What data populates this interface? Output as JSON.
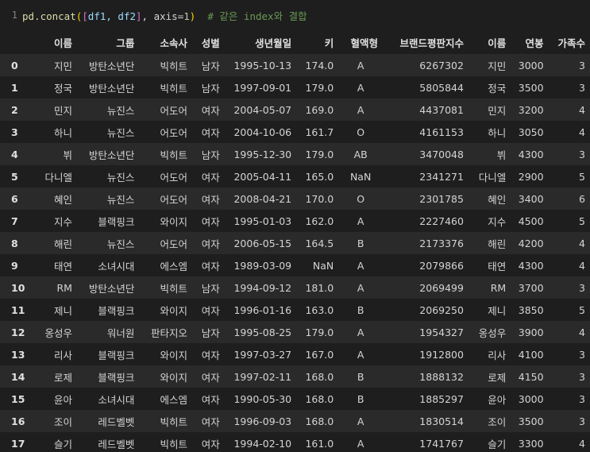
{
  "code_cell": {
    "line_number": "1",
    "code_fn": "pd.concat",
    "code_open": "(",
    "code_list_open": "[",
    "code_args": "df1, df2",
    "code_list_close": "]",
    "code_kw": ", axis=",
    "code_num": "1",
    "code_close": ")",
    "comment": "# 같은 index와 결합"
  },
  "table": {
    "columns": [
      "",
      "이름",
      "그룹",
      "소속사",
      "성별",
      "생년월일",
      "키",
      "혈액형",
      "브랜드평판지수",
      "이름",
      "연봉",
      "가족수"
    ],
    "rows": [
      [
        "0",
        "지민",
        "방탄소년단",
        "빅히트",
        "남자",
        "1995-10-13",
        "174.0",
        "A",
        "6267302",
        "지민",
        "3000",
        "3"
      ],
      [
        "1",
        "정국",
        "방탄소년단",
        "빅히트",
        "남자",
        "1997-09-01",
        "179.0",
        "A",
        "5805844",
        "정국",
        "3500",
        "3"
      ],
      [
        "2",
        "민지",
        "뉴진스",
        "어도어",
        "여자",
        "2004-05-07",
        "169.0",
        "A",
        "4437081",
        "민지",
        "3200",
        "4"
      ],
      [
        "3",
        "하니",
        "뉴진스",
        "어도어",
        "여자",
        "2004-10-06",
        "161.7",
        "O",
        "4161153",
        "하니",
        "3050",
        "4"
      ],
      [
        "4",
        "뷔",
        "방탄소년단",
        "빅히트",
        "남자",
        "1995-12-30",
        "179.0",
        "AB",
        "3470048",
        "뷔",
        "4300",
        "3"
      ],
      [
        "5",
        "다니엘",
        "뉴진스",
        "어도어",
        "여자",
        "2005-04-11",
        "165.0",
        "NaN",
        "2341271",
        "다니엘",
        "2900",
        "5"
      ],
      [
        "6",
        "혜인",
        "뉴진스",
        "어도어",
        "여자",
        "2008-04-21",
        "170.0",
        "O",
        "2301785",
        "혜인",
        "3400",
        "6"
      ],
      [
        "7",
        "지수",
        "블랙핑크",
        "와이지",
        "여자",
        "1995-01-03",
        "162.0",
        "A",
        "2227460",
        "지수",
        "4500",
        "5"
      ],
      [
        "8",
        "해린",
        "뉴진스",
        "어도어",
        "여자",
        "2006-05-15",
        "164.5",
        "B",
        "2173376",
        "해린",
        "4200",
        "4"
      ],
      [
        "9",
        "태연",
        "소녀시대",
        "에스엠",
        "여자",
        "1989-03-09",
        "NaN",
        "A",
        "2079866",
        "태연",
        "4300",
        "4"
      ],
      [
        "10",
        "RM",
        "방탄소년단",
        "빅히트",
        "남자",
        "1994-09-12",
        "181.0",
        "A",
        "2069499",
        "RM",
        "3700",
        "3"
      ],
      [
        "11",
        "제니",
        "블랙핑크",
        "와이지",
        "여자",
        "1996-01-16",
        "163.0",
        "B",
        "2069250",
        "제니",
        "3850",
        "5"
      ],
      [
        "12",
        "옹성우",
        "워너원",
        "판타지오",
        "남자",
        "1995-08-25",
        "179.0",
        "A",
        "1954327",
        "옹성우",
        "3900",
        "4"
      ],
      [
        "13",
        "리사",
        "블랙핑크",
        "와이지",
        "여자",
        "1997-03-27",
        "167.0",
        "A",
        "1912800",
        "리사",
        "4100",
        "3"
      ],
      [
        "14",
        "로제",
        "블랙핑크",
        "와이지",
        "여자",
        "1997-02-11",
        "168.0",
        "B",
        "1888132",
        "로제",
        "4150",
        "3"
      ],
      [
        "15",
        "윤아",
        "소녀시대",
        "에스엠",
        "여자",
        "1990-05-30",
        "168.0",
        "B",
        "1885297",
        "윤아",
        "3000",
        "3"
      ],
      [
        "16",
        "조이",
        "레드벨벳",
        "빅히트",
        "여자",
        "1996-09-03",
        "168.0",
        "A",
        "1830514",
        "조이",
        "3500",
        "3"
      ],
      [
        "17",
        "슬기",
        "레드벨벳",
        "빅히트",
        "여자",
        "1994-02-10",
        "161.0",
        "A",
        "1741767",
        "슬기",
        "3300",
        "4"
      ]
    ]
  }
}
